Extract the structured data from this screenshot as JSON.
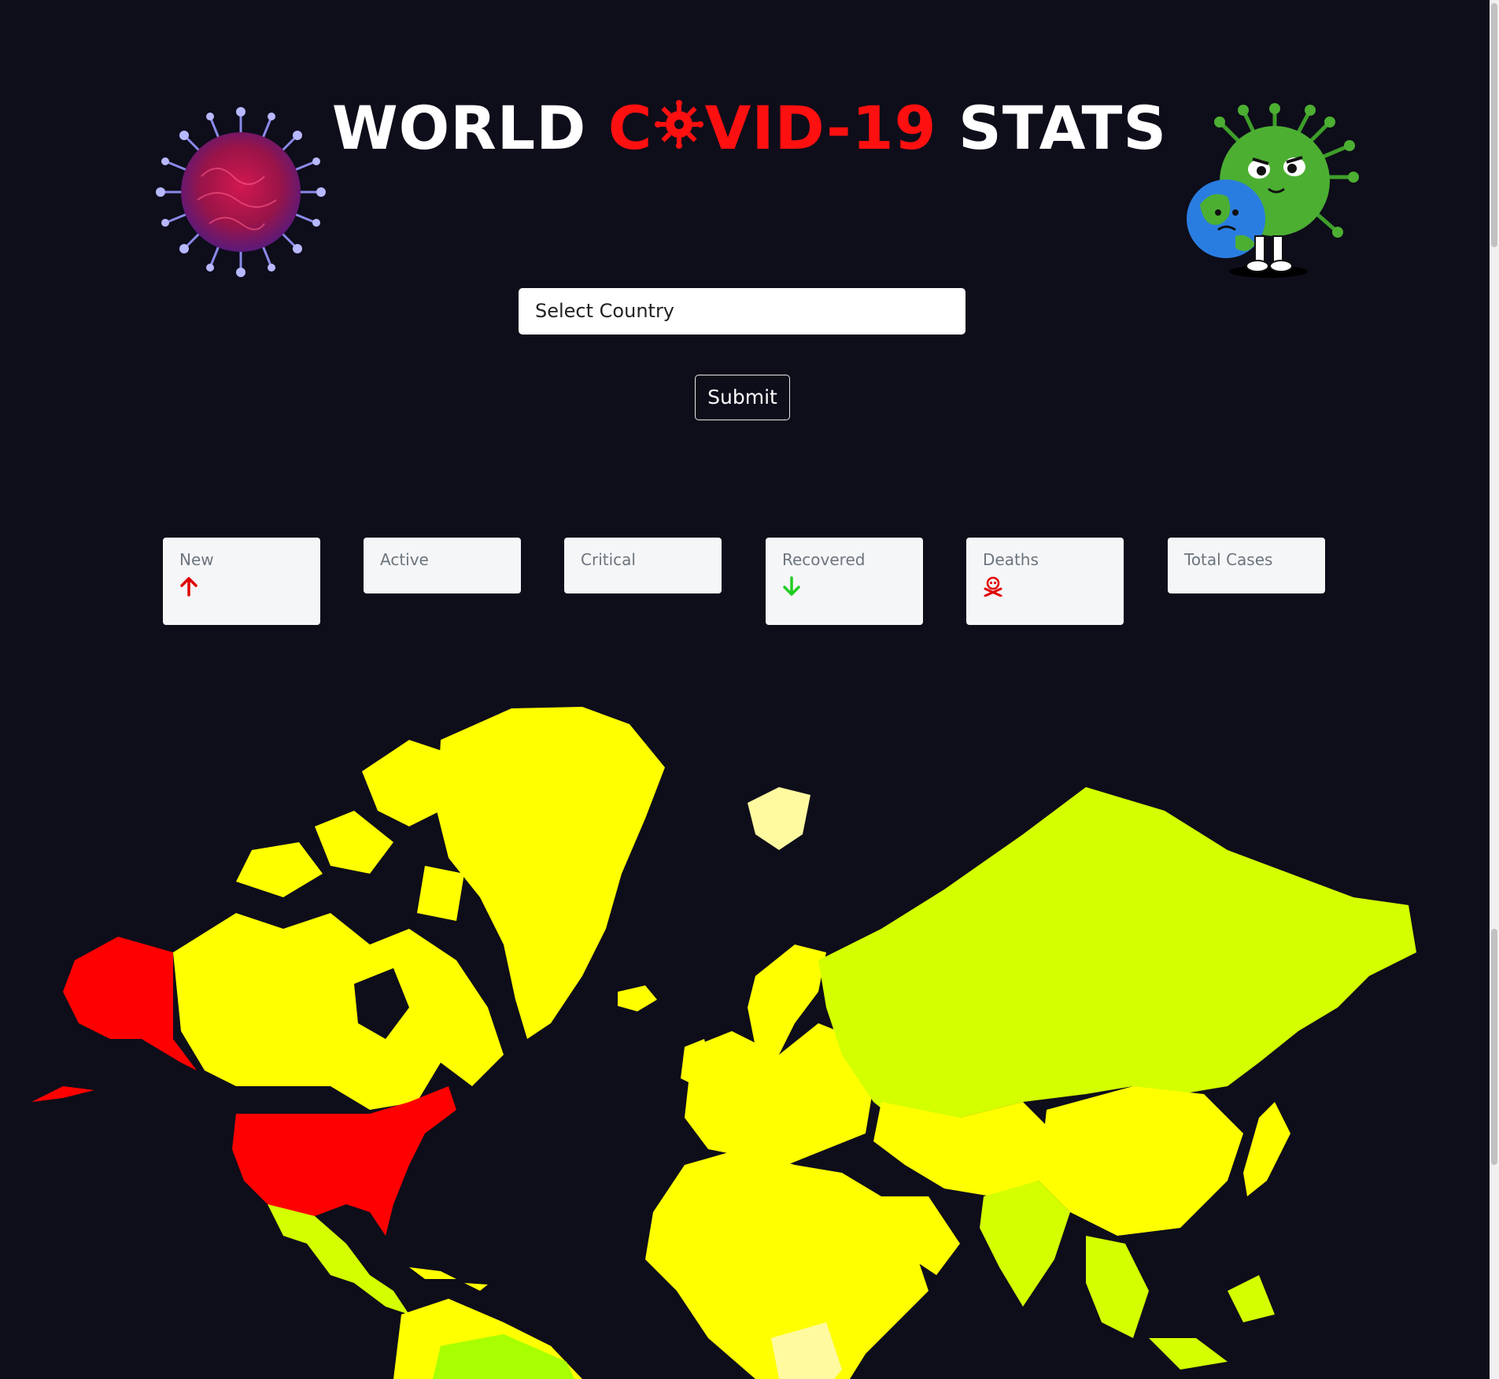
{
  "header": {
    "title_part1": "WORLD",
    "title_part2_c": "C",
    "title_part2_rest": "VID-19",
    "title_part3": "STATS",
    "accent_color": "#ff1010",
    "left_image": "coronavirus-illustration",
    "right_image": "cartoon-virus-hugging-earth"
  },
  "form": {
    "select_placeholder": "Select Country",
    "submit_label": "Submit"
  },
  "stats": {
    "new": {
      "label": "New",
      "icon": "arrow-up-icon",
      "color": "#e00000"
    },
    "active": {
      "label": "Active"
    },
    "critical": {
      "label": "Critical"
    },
    "recovered": {
      "label": "Recovered",
      "icon": "arrow-down-icon",
      "color": "#22cc22"
    },
    "deaths": {
      "label": "Deaths",
      "icon": "skull-crossbones-icon",
      "color": "#e00000"
    },
    "total": {
      "label": "Total Cases"
    }
  },
  "map": {
    "type": "choropleth-world-map",
    "palette": [
      "#ff0000",
      "#ffff00",
      "#d4ff00",
      "#a8ff00",
      "#fffaa0"
    ]
  }
}
